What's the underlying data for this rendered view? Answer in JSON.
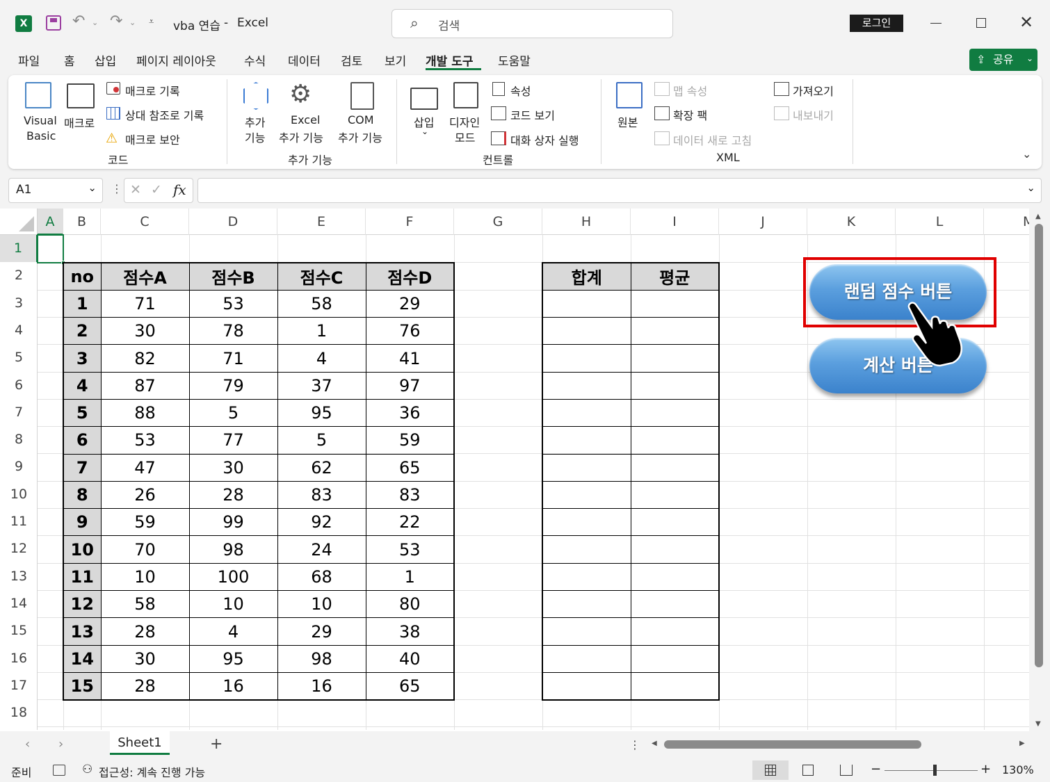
{
  "titlebar": {
    "filename": "vba 연습",
    "separator": "-",
    "app": "Excel",
    "search_placeholder": "검색",
    "login_label": "로그인"
  },
  "menu": [
    "파일",
    "홈",
    "삽입",
    "페이지 레이아웃",
    "수식",
    "데이터",
    "검토",
    "보기",
    "개발 도구",
    "도움말"
  ],
  "menu_active": "개발 도구",
  "share_label": "공유",
  "ribbon": {
    "code": {
      "group": "코드",
      "visual_basic": [
        "Visual",
        "Basic"
      ],
      "macro": "매크로",
      "record_macro": "매크로 기록",
      "relative_ref": "상대 참조로 기록",
      "macro_security": "매크로 보안"
    },
    "addins": {
      "group": "추가 기능",
      "addins": [
        "추가",
        "기능"
      ],
      "excel_addins": [
        "Excel",
        "추가 기능"
      ],
      "com_addins": [
        "COM",
        "추가 기능"
      ]
    },
    "controls": {
      "group": "컨트롤",
      "insert": "삽입",
      "design_mode": [
        "디자인",
        "모드"
      ],
      "properties": "속성",
      "view_code": "코드 보기",
      "run_dialog": "대화 상자 실행"
    },
    "xml": {
      "group": "XML",
      "source": "원본",
      "map_properties": "맵 속성",
      "expansion_packs": "확장 팩",
      "refresh_data": "데이터 새로 고침",
      "import": "가져오기",
      "export": "내보내기"
    }
  },
  "formula": {
    "namebox": "A1",
    "fx": "fx",
    "value": ""
  },
  "columns": [
    "A",
    "B",
    "C",
    "D",
    "E",
    "F",
    "G",
    "H",
    "I",
    "J",
    "K",
    "L",
    "M"
  ],
  "rows": [
    "1",
    "2",
    "3",
    "4",
    "5",
    "6",
    "7",
    "8",
    "9",
    "10",
    "11",
    "12",
    "13",
    "14",
    "15",
    "16",
    "17",
    "18"
  ],
  "score_table": {
    "headers": [
      "no",
      "점수A",
      "점수B",
      "점수C",
      "점수D"
    ],
    "rows": [
      [
        "1",
        "71",
        "53",
        "58",
        "29"
      ],
      [
        "2",
        "30",
        "78",
        "1",
        "76"
      ],
      [
        "3",
        "82",
        "71",
        "4",
        "41"
      ],
      [
        "4",
        "87",
        "79",
        "37",
        "97"
      ],
      [
        "5",
        "88",
        "5",
        "95",
        "36"
      ],
      [
        "6",
        "53",
        "77",
        "5",
        "59"
      ],
      [
        "7",
        "47",
        "30",
        "62",
        "65"
      ],
      [
        "8",
        "26",
        "28",
        "83",
        "83"
      ],
      [
        "9",
        "59",
        "99",
        "92",
        "22"
      ],
      [
        "10",
        "70",
        "98",
        "24",
        "53"
      ],
      [
        "11",
        "10",
        "100",
        "68",
        "1"
      ],
      [
        "12",
        "58",
        "10",
        "10",
        "80"
      ],
      [
        "13",
        "28",
        "4",
        "29",
        "38"
      ],
      [
        "14",
        "30",
        "95",
        "98",
        "40"
      ],
      [
        "15",
        "28",
        "16",
        "16",
        "65"
      ]
    ]
  },
  "result_table": {
    "headers": [
      "합계",
      "평균"
    ],
    "row_count": 15
  },
  "buttons": {
    "random": "랜덤 점수 버튼",
    "calc": "계산 버튼"
  },
  "sheet_tab": "Sheet1",
  "status": {
    "ready": "준비",
    "accessibility": "접근성: 계속 진행 가능",
    "zoom": "130%"
  }
}
